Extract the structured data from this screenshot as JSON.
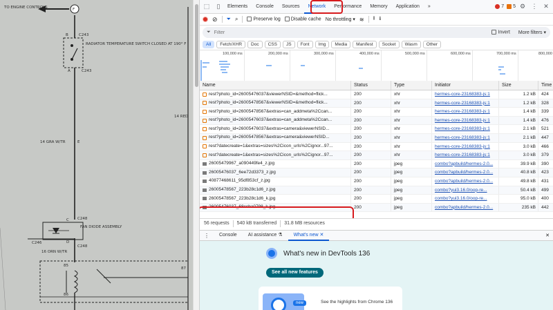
{
  "diagram": {
    "labels": {
      "to_engine_controls": "TO ENGINE CONTROLS",
      "connector_f": "F",
      "connector_b": "B",
      "c243_top": "C243",
      "radiator_switch": "RADIATOR TEMPERATURE SWITCH CLOSED AT 190° F",
      "connector_a": "A",
      "c243_bottom": "C243",
      "wire_14_red": "14 RED",
      "wire_14_gra": "14 GRA W/TR",
      "wire_e": "E",
      "c248_top": "C248",
      "fan_diode": "FAN DIODE ASSEMBLY",
      "c246": "C246",
      "c248_bottom": "C248",
      "wire_16_orn": "16 ORN W/TR",
      "connector_c": "C",
      "connector_d": "D",
      "relay_85": "85",
      "relay_86": "86",
      "relay_87": "87"
    }
  },
  "devtools": {
    "tabs": [
      "Elements",
      "Console",
      "Sources",
      "Network",
      "Performance",
      "Memory",
      "Application",
      "»"
    ],
    "active_tab": "Network",
    "errors_count": "7",
    "warnings_count": "5",
    "toolbar": {
      "preserve_log": "Preserve log",
      "disable_cache": "Disable cache",
      "throttling": "No throttling"
    },
    "filter": {
      "placeholder": "Filter",
      "invert": "Invert",
      "more_filters": "More filters"
    },
    "type_filters": [
      "All",
      "Fetch/XHR",
      "Doc",
      "CSS",
      "JS",
      "Font",
      "Img",
      "Media",
      "Manifest",
      "Socket",
      "Wasm",
      "Other"
    ],
    "timeline_ticks": [
      "100,000 ms",
      "200,000 ms",
      "300,000 ms",
      "400,000 ms",
      "500,000 ms",
      "600,000 ms",
      "700,000 ms",
      "800,000"
    ],
    "columns": [
      "Name",
      "Status",
      "Type",
      "Initiator",
      "Size",
      "Time"
    ],
    "requests": [
      {
        "name": "rest?photo_id=26005476037&viewerNSID=&method=flick...",
        "status": "200",
        "type": "xhr",
        "initiator": "hermes-core-23168383-js:1",
        "size": "1.2 kB",
        "time": "424"
      },
      {
        "name": "rest?photo_id=26005478567&viewerNSID=&method=flick...",
        "status": "200",
        "type": "xhr",
        "initiator": "hermes-core-23168383-js:1",
        "size": "1.2 kB",
        "time": "328"
      },
      {
        "name": "rest?photo_id=26005478567&extras=can_addmeta%2Ccan...",
        "status": "200",
        "type": "xhr",
        "initiator": "hermes-core-23168383-js:1",
        "size": "1.4 kB",
        "time": "339"
      },
      {
        "name": "rest?photo_id=26005476037&extras=can_addmeta%2Ccan...",
        "status": "200",
        "type": "xhr",
        "initiator": "hermes-core-23168383-js:1",
        "size": "1.4 kB",
        "time": "476"
      },
      {
        "name": "rest?photo_id=26005476037&extras=camera&viewerNSID...",
        "status": "200",
        "type": "xhr",
        "initiator": "hermes-core-23168383-js:1",
        "size": "2.1 kB",
        "time": "521"
      },
      {
        "name": "rest?photo_id=26005478567&extras=camera&viewerNSID...",
        "status": "200",
        "type": "xhr",
        "initiator": "hermes-core-23168383-js:1",
        "size": "2.1 kB",
        "time": "447"
      },
      {
        "name": "rest?datecreate=1&extras=sizes%2Cicon_urls%2Cignor...97...",
        "status": "200",
        "type": "xhr",
        "initiator": "hermes-core-23168383-js:1",
        "size": "3.0 kB",
        "time": "466"
      },
      {
        "name": "rest?datecreate=1&extras=sizes%2Cicon_urls%2Cignor...97...",
        "status": "200",
        "type": "xhr",
        "initiator": "hermes-core-23168383-js:1",
        "size": "3.0 kB",
        "time": "379"
      },
      {
        "name": "26005479967_a090449fe4_z.jpg",
        "status": "200",
        "type": "jpeg",
        "initiator": "combo?apbuild/hermes-2.0...",
        "size": "39.9 kB",
        "time": "390"
      },
      {
        "name": "26005476037_6ee72d3373_z.jpg",
        "status": "200",
        "type": "jpeg",
        "initiator": "combo?apbuild/hermes-2.0...",
        "size": "40.8 kB",
        "time": "423"
      },
      {
        "name": "40877468611_95df853cf_z.jpg",
        "status": "200",
        "type": "jpeg",
        "initiator": "combo?apbuild/hermes-2.0...",
        "size": "49.8 kB",
        "time": "431"
      },
      {
        "name": "26005478567_223b28c1d6_z.jpg",
        "status": "200",
        "type": "jpeg",
        "initiator": "combo?yui3.16.0/oop-re...",
        "size": "50.4 kB",
        "time": "499"
      },
      {
        "name": "26005478567_223b28c1d6_k.jpg",
        "status": "200",
        "type": "jpeg",
        "initiator": "combo?yui3.16.0/oop-re...",
        "size": "95.0 kB",
        "time": "400"
      },
      {
        "name": "26005476037_68ccba0798_k.jpg",
        "status": "200",
        "type": "jpeg",
        "initiator": "combo?apbuild/hermes-2.0...",
        "size": "235 kB",
        "time": "442"
      }
    ],
    "summary": {
      "requests": "56 requests",
      "transferred": "540 kB transferred",
      "resources": "31.8 MB resources"
    },
    "drawer_tabs": [
      "Console",
      "AI assistance",
      "What's new"
    ],
    "whats_new": {
      "title": "What's new in DevTools 136",
      "button": "See all new features",
      "badge": "new",
      "card_text": "See the highlights from Chrome 136"
    }
  }
}
